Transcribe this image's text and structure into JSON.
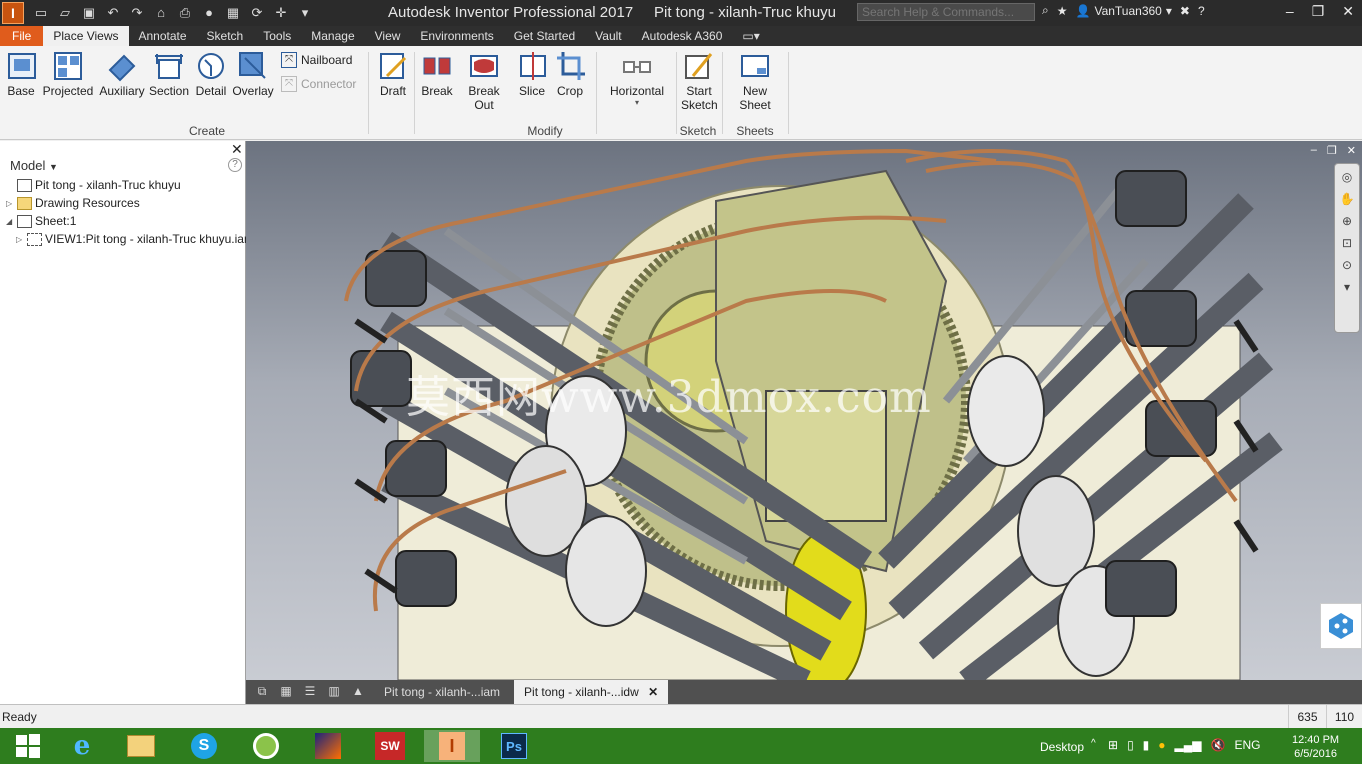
{
  "titlebar": {
    "logo": "I",
    "app_title": "Autodesk Inventor Professional 2017",
    "document_title": "Pit tong - xilanh-Truc khuyu",
    "search_placeholder": "Search Help & Commands...",
    "user": "VanTuan360"
  },
  "tabs": [
    "File",
    "Place Views",
    "Annotate",
    "Sketch",
    "Tools",
    "Manage",
    "View",
    "Environments",
    "Get Started",
    "Vault",
    "Autodesk A360"
  ],
  "active_tab": "Place Views",
  "ribbon": {
    "create": {
      "buttons": [
        "Base",
        "Projected",
        "Auxiliary",
        "Section",
        "Detail",
        "Overlay"
      ],
      "small": [
        "Nailboard",
        "Connector"
      ],
      "label": "Create"
    },
    "modify": {
      "buttons": [
        "Draft",
        "Break",
        "Break Out",
        "Slice",
        "Crop",
        "Horizontal"
      ],
      "label": "Modify"
    },
    "sketch": {
      "button_line1": "Start",
      "button_line2": "Sketch",
      "label": "Sketch"
    },
    "sheets": {
      "button": "New Sheet",
      "label": "Sheets"
    }
  },
  "browser": {
    "header": "Model",
    "items": [
      {
        "label": "Pit tong - xilanh-Truc khuyu"
      },
      {
        "label": "Drawing Resources"
      },
      {
        "label": "Sheet:1"
      },
      {
        "label": "VIEW1:Pit tong - xilanh-Truc khuyu.iam"
      }
    ]
  },
  "canvas": {
    "watermark": "莫西网www.3dmox.com"
  },
  "document_tabs": [
    "Pit tong - xilanh-...iam",
    "Pit tong - xilanh-...idw"
  ],
  "status": {
    "text": "Ready",
    "x": "635",
    "y": "110"
  },
  "taskbar": {
    "desktop_label": "Desktop",
    "language": "ENG",
    "time": "12:40 PM",
    "date": "6/5/2016",
    "apps": [
      "windows-start",
      "internet-explorer",
      "file-explorer",
      "skype",
      "greenshot",
      "media-app",
      "solidworks-2016",
      "inventor-pro",
      "photoshop"
    ]
  },
  "colors": {
    "file_tab": "#e05c1c",
    "taskbar": "#2e7d1e",
    "titlebar": "#2b2b2b",
    "copper_tube": "#b97a4a",
    "gear": "#c9c98a"
  }
}
